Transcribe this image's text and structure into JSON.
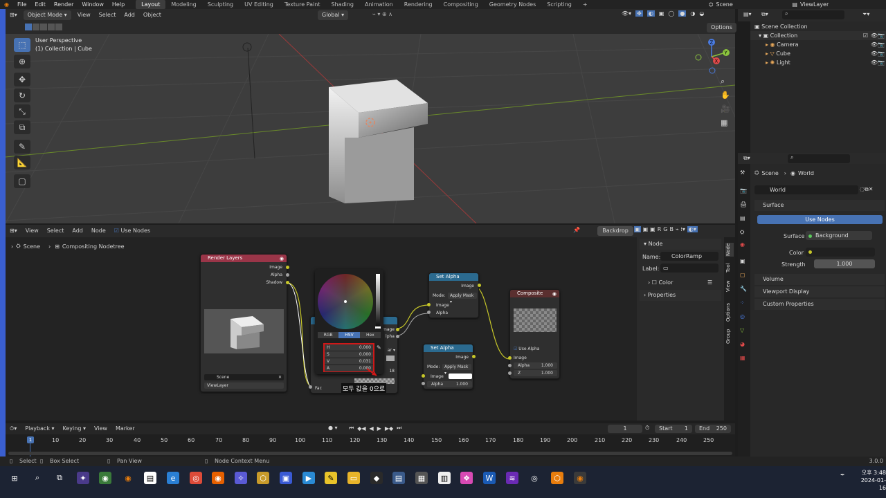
{
  "menu": {
    "items": [
      "File",
      "Edit",
      "Render",
      "Window",
      "Help"
    ],
    "workspaces": [
      "Layout",
      "Modeling",
      "Sculpting",
      "UV Editing",
      "Texture Paint",
      "Shading",
      "Animation",
      "Rendering",
      "Compositing",
      "Geometry Nodes",
      "Scripting"
    ],
    "active_workspace": "Layout",
    "add_tab": "+",
    "scene": "Scene",
    "view_layer": "ViewLayer"
  },
  "viewport_header": {
    "mode": "Object Mode",
    "menus": [
      "View",
      "Select",
      "Add",
      "Object"
    ],
    "orientation": "Global",
    "options": "Options"
  },
  "viewport": {
    "perspective": "User Perspective",
    "collection_info": "(1) Collection | Cube"
  },
  "outliner": {
    "root": "Scene Collection",
    "collection": "Collection",
    "items": [
      "Camera",
      "Cube",
      "Light"
    ]
  },
  "properties": {
    "breadcrumb_scene": "Scene",
    "breadcrumb_world": "World",
    "world_name": "World",
    "surface_panel": "Surface",
    "use_nodes": "Use Nodes",
    "surface_label": "Surface",
    "surface_value": "Background",
    "color_label": "Color",
    "strength_label": "Strength",
    "strength_value": "1.000",
    "panels": [
      "Volume",
      "Viewport Display",
      "Custom Properties"
    ]
  },
  "node_header": {
    "menus": [
      "View",
      "Select",
      "Add",
      "Node"
    ],
    "use_nodes": "Use Nodes",
    "backdrop": "Backdrop",
    "rgb_letters": [
      "R",
      "G",
      "B"
    ]
  },
  "node_breadcrumb": {
    "scene": "Scene",
    "tree": "Compositing Nodetree"
  },
  "nodes": {
    "render_layers": {
      "title": "Render Layers",
      "outputs": [
        "Image",
        "Alpha",
        "Shadow"
      ],
      "scene": "Scene",
      "view_layer": "ViewLayer"
    },
    "color_picker": {
      "tabs": [
        "RGB",
        "HSV",
        "Hex"
      ],
      "active_tab": "HSV",
      "fields": [
        {
          "label": "H",
          "value": "0.000"
        },
        {
          "label": "S",
          "value": "0.000"
        },
        {
          "label": "V",
          "value": "0.031"
        },
        {
          "label": "A",
          "value": "0.000"
        }
      ],
      "fac_label": "Fac",
      "annotation": "모두 값을 0으로",
      "partial_outputs": [
        "mage",
        "lpha"
      ],
      "partial_dropdown": "ar",
      "partial_value": "18"
    },
    "set_alpha_1": {
      "title": "Set Alpha",
      "output": "Image",
      "mode_label": "Mode:",
      "mode_value": "Apply Mask",
      "inputs": [
        "Image",
        "Alpha"
      ]
    },
    "set_alpha_2": {
      "title": "Set Alpha",
      "output": "Image",
      "mode_label": "Mode:",
      "mode_value": "Apply Mask",
      "image_label": "Image",
      "alpha_label": "Alpha",
      "alpha_value": "1.000"
    },
    "composite": {
      "title": "Composite",
      "use_alpha": "Use Alpha",
      "image_label": "Image",
      "alpha_label": "Alpha",
      "alpha_value": "1.000",
      "z_label": "Z",
      "z_value": "1.000"
    }
  },
  "node_sidebar": {
    "panel": "Node",
    "name_label": "Name:",
    "name_value": "ColorRamp",
    "label_label": "Label:",
    "color_panel": "Color",
    "properties_panel": "Properties",
    "tabs": [
      "Node",
      "Tool",
      "View",
      "Options",
      "Group"
    ]
  },
  "timeline": {
    "menus": [
      "Playback",
      "Keying",
      "View",
      "Marker"
    ],
    "current_frame": "1",
    "start_label": "Start",
    "start_value": "1",
    "end_label": "End",
    "end_value": "250",
    "ticks": [
      "1",
      "10",
      "20",
      "30",
      "40",
      "50",
      "60",
      "70",
      "80",
      "90",
      "100",
      "110",
      "120",
      "130",
      "140",
      "150",
      "160",
      "170",
      "180",
      "190",
      "200",
      "210",
      "220",
      "230",
      "240",
      "250"
    ]
  },
  "statusbar": {
    "select": "Select",
    "box_select": "Box Select",
    "pan_view": "Pan View",
    "context_menu": "Node Context Menu",
    "version": "3.0.0"
  },
  "taskbar": {
    "time": "오후 3:48",
    "date": "2024-01-16"
  },
  "colors": {
    "accent": "#4772b3",
    "render_layers_header": "#9a3548",
    "set_alpha_header": "#2b6a8f",
    "composite_header": "#5a2f2f",
    "socket_yellow": "#c7c729",
    "socket_gray": "#a1a1a1",
    "annotation_red": "#d01818"
  }
}
